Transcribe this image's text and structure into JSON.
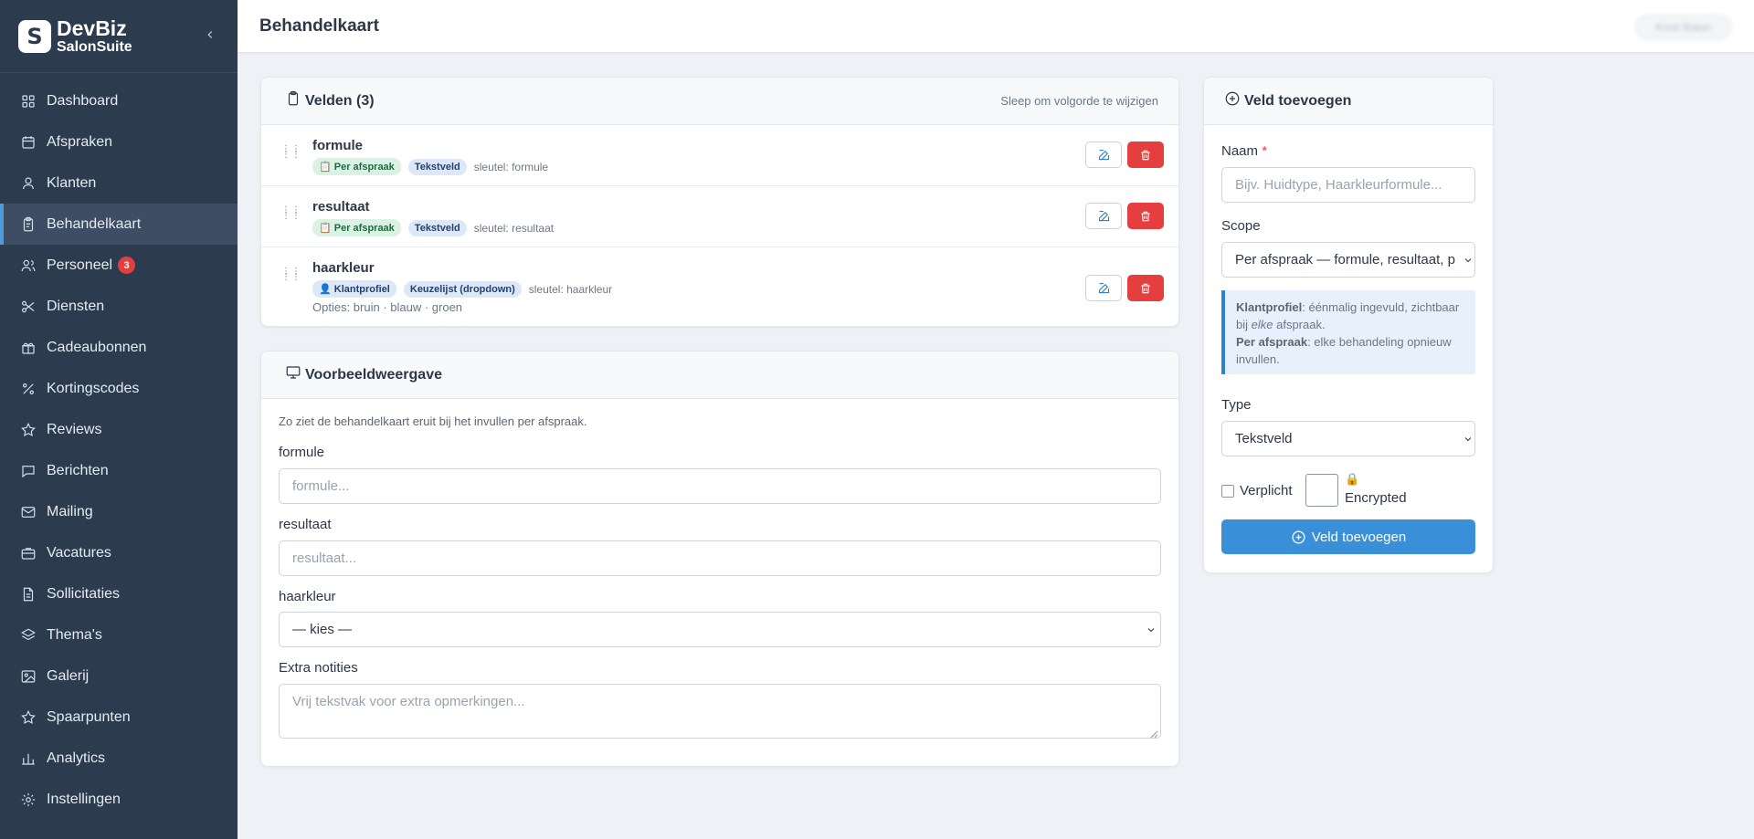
{
  "brand": {
    "name": "DevBiz",
    "sub": "SalonSuite",
    "logo_letter": "S"
  },
  "sidebar": {
    "items": [
      {
        "label": "Dashboard",
        "icon": "grid-icon"
      },
      {
        "label": "Afspraken",
        "icon": "calendar-icon"
      },
      {
        "label": "Klanten",
        "icon": "user-icon"
      },
      {
        "label": "Behandelkaart",
        "icon": "clipboard-icon",
        "active": true
      },
      {
        "label": "Personeel",
        "icon": "users-icon",
        "badge": "3"
      },
      {
        "label": "Diensten",
        "icon": "scissors-icon"
      },
      {
        "label": "Cadeaubonnen",
        "icon": "gift-icon"
      },
      {
        "label": "Kortingscodes",
        "icon": "percent-icon"
      },
      {
        "label": "Reviews",
        "icon": "star-icon"
      },
      {
        "label": "Berichten",
        "icon": "message-icon"
      },
      {
        "label": "Mailing",
        "icon": "mail-icon"
      },
      {
        "label": "Vacatures",
        "icon": "briefcase-icon"
      },
      {
        "label": "Sollicitaties",
        "icon": "file-icon"
      },
      {
        "label": "Thema's",
        "icon": "layers-icon"
      },
      {
        "label": "Galerij",
        "icon": "image-icon"
      },
      {
        "label": "Spaarpunten",
        "icon": "award-icon"
      },
      {
        "label": "Analytics",
        "icon": "bar-chart-icon"
      },
      {
        "label": "Instellingen",
        "icon": "gear-icon"
      }
    ]
  },
  "header": {
    "title": "Behandelkaart",
    "user": "Kristi Baker"
  },
  "fields": {
    "title": "Velden (3)",
    "hint": "Sleep om volgorde te wijzigen",
    "rows": [
      {
        "name": "formule",
        "scope": "📋 Per afspraak",
        "scope_color": "green",
        "type": "Tekstveld",
        "key": "sleutel: formule",
        "options": ""
      },
      {
        "name": "resultaat",
        "scope": "📋 Per afspraak",
        "scope_color": "green",
        "type": "Tekstveld",
        "key": "sleutel: resultaat",
        "options": ""
      },
      {
        "name": "haarkleur",
        "scope": "👤 Klantprofiel",
        "scope_color": "blue",
        "type": "Keuzelijst (dropdown)",
        "key": "sleutel: haarkleur",
        "options": "Opties: bruin · blauw · groen"
      }
    ]
  },
  "preview": {
    "title": "Voorbeeldweergave",
    "description": "Zo ziet de behandelkaart eruit bij het invullen per afspraak.",
    "formule_label": "formule",
    "formule_placeholder": "formule...",
    "resultaat_label": "resultaat",
    "resultaat_placeholder": "resultaat...",
    "haarkleur_label": "haarkleur",
    "haarkleur_value": "— kies —",
    "notes_label": "Extra notities",
    "notes_placeholder": "Vrij tekstvak voor extra opmerkingen..."
  },
  "add_field": {
    "title": "Veld toevoegen",
    "name_label": "Naam",
    "name_required": "*",
    "name_placeholder": "Bijv. Huidtype, Haarkleurformule...",
    "scope_label": "Scope",
    "scope_value": "Per afspraak — formule, resultaat, p",
    "info_klant_title": "Klantprofiel",
    "info_klant_text_1": ": éénmalig ingevuld, zichtbaar bij ",
    "info_klant_em": "elke",
    "info_klant_text_2": " afspraak.",
    "info_afspraak_title": "Per afspraak",
    "info_afspraak_text": ": elke behandeling opnieuw invullen.",
    "type_label": "Type",
    "type_value": "Tekstveld",
    "required_label": "Verplicht",
    "encrypted_lock": "🔒",
    "encrypted_label": "Encrypted",
    "submit_label": "Veld toevoegen"
  },
  "colors": {
    "sidebar_bg": "#2d3b4f",
    "accent": "#3a8fd9",
    "danger": "#e53e3e"
  }
}
